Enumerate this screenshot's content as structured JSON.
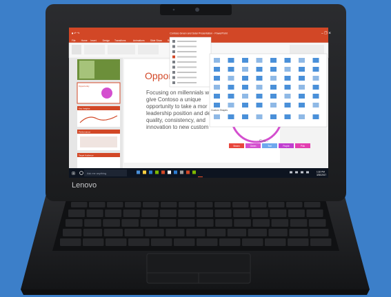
{
  "colors": {
    "background": "#3c7fc9",
    "laptop_body": "#1e1f21",
    "ppt_accent": "#d24726",
    "taskbar": "#0d1420"
  },
  "laptop": {
    "brand": "Lenovo"
  },
  "powerpoint": {
    "window_title": "Contoso Green and Solar Presentation - PowerPoint",
    "ribbon_tabs": [
      "File",
      "Home",
      "Insert",
      "Design",
      "Transitions",
      "Animations",
      "Slide Show",
      "Review",
      "View"
    ],
    "slide_title": "Oppor",
    "slide_body_lines": [
      "Focusing on millennials w",
      "give Contoso a unique",
      "opportunity to take a mor",
      "leadership position and de",
      "quality, consistency, and",
      "innovation to new custom"
    ],
    "thumb_labels": [
      "Opportunity",
      "Key Insights",
      "Performance",
      "Target Audience"
    ],
    "dropdown_section": "Custom Shapes",
    "pie_label": "C.rs...",
    "color_chips": [
      {
        "label": "Brown",
        "color": "#e8463c"
      },
      {
        "label": "Green",
        "color": "#d44fcf"
      },
      {
        "label": "Teal",
        "color": "#6fa8ee"
      },
      {
        "label": "Purple",
        "color": "#c03fd0"
      },
      {
        "label": "Pink",
        "color": "#e33eb0"
      }
    ]
  },
  "taskbar": {
    "search_placeholder": "Ask me anything",
    "time": "1:32 PM",
    "date": "3/30/2017"
  }
}
